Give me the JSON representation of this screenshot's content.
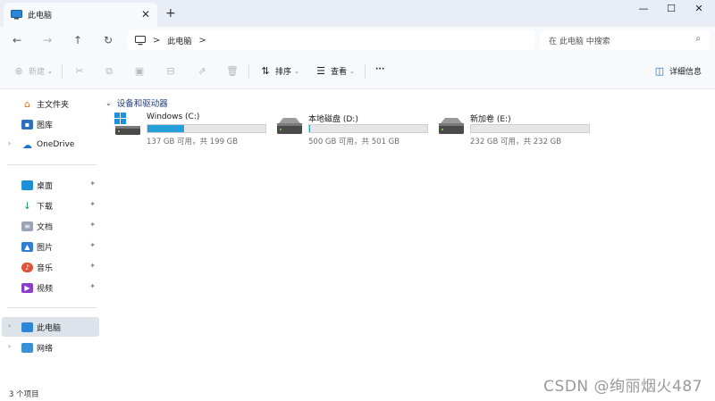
{
  "tab": {
    "title": "此电脑",
    "close": "✕",
    "new_tab": "+"
  },
  "window_controls": {
    "minimize": "—",
    "maximize": "☐",
    "close": "✕"
  },
  "nav": {
    "back": "←",
    "forward": "→",
    "up": "↑",
    "refresh": "↻"
  },
  "address": {
    "crumb": "此电脑",
    "sep": ">",
    "trail": ">"
  },
  "search": {
    "placeholder": "在 此电脑 中搜索",
    "icon": "⌕"
  },
  "toolbar": {
    "new_label": "新建",
    "sort_label": "排序",
    "view_label": "查看",
    "more_label": "···",
    "details_label": "详细信息"
  },
  "sidebar": {
    "home": "主文件夹",
    "gallery": "图库",
    "onedrive": "OneDrive",
    "desktop": "桌面",
    "downloads": "下载",
    "documents": "文档",
    "pictures": "图片",
    "music": "音乐",
    "videos": "视频",
    "this_pc": "此电脑",
    "network": "网络"
  },
  "content": {
    "group_title": "设备和驱动器",
    "drives": [
      {
        "name": "Windows (C:)",
        "info": "137 GB 可用，共 199 GB",
        "used_fraction": 0.31
      },
      {
        "name": "本地磁盘 (D:)",
        "info": "500 GB 可用，共 501 GB",
        "used_fraction": 0.002
      },
      {
        "name": "新加卷 (E:)",
        "info": "232 GB 可用，共 232 GB",
        "used_fraction": 0.0
      }
    ]
  },
  "status": {
    "item_count": "3 个项目"
  },
  "watermark": "CSDN @绚丽烟火487",
  "colors": {
    "accent": "#26a0da",
    "selected_bg": "#dde3ea",
    "titlebar_bg": "#e8edf6"
  }
}
